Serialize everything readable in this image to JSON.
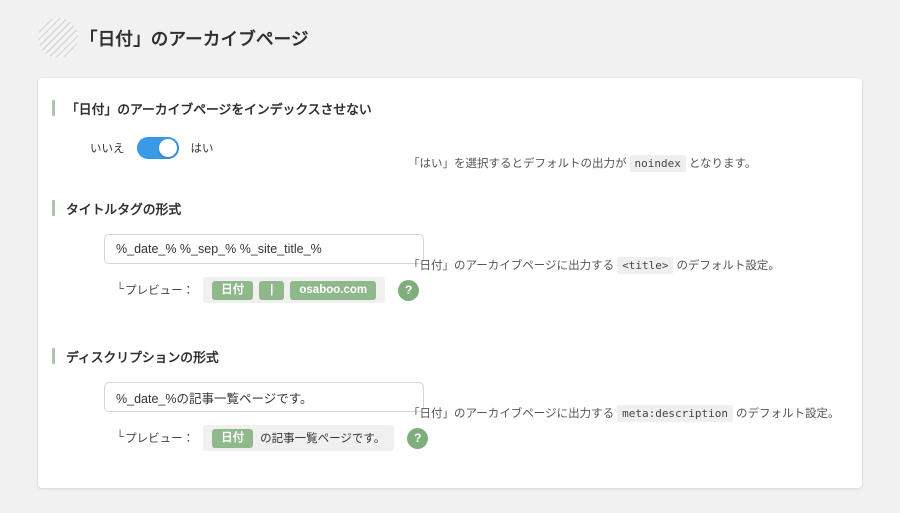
{
  "page": {
    "title": "「日付」のアーカイブページ",
    "header_icon": "hatched-circle-icon"
  },
  "sections": {
    "noindex": {
      "heading": "「日付」のアーカイブページをインデックスさせない",
      "toggle": {
        "off_label": "いいえ",
        "on_label": "はい",
        "state": "on",
        "color": "#3b9ae6"
      },
      "hint_prefix": "「はい」を選択するとデフォルトの出力が",
      "hint_code": "noindex",
      "hint_suffix": "となります。"
    },
    "title_tag": {
      "heading": "タイトルタグの形式",
      "input_value": "%_date_% %_sep_% %_site_title_%",
      "input_placeholder": "%_date_% %_sep_% %_site_title_%",
      "hint_prefix": "「日付」のアーカイブページに出力する",
      "hint_code": "<title>",
      "hint_suffix": "のデフォルト設定。",
      "preview": {
        "corner": "└",
        "label": "プレビュー：",
        "chips": [
          "日付",
          "|",
          "osaboo.com"
        ],
        "help_label": "?"
      }
    },
    "description": {
      "heading": "ディスクリプションの形式",
      "input_value": "%_date_%の記事一覧ページです。",
      "input_placeholder": "%_date_%の記事一覧ページです。",
      "hint_prefix": "「日付」のアーカイブページに出力する",
      "hint_code": "meta:description",
      "hint_suffix": "のデフォルト設定。",
      "preview": {
        "corner": "└",
        "label": "プレビュー：",
        "chip": "日付",
        "plain_text": "の記事一覧ページです。",
        "help_label": "?"
      }
    }
  },
  "colors": {
    "accent_green": "#8fb98b",
    "toggle_blue": "#3b9ae6",
    "page_background": "#f1f1f2",
    "card_background": "#ffffff"
  }
}
